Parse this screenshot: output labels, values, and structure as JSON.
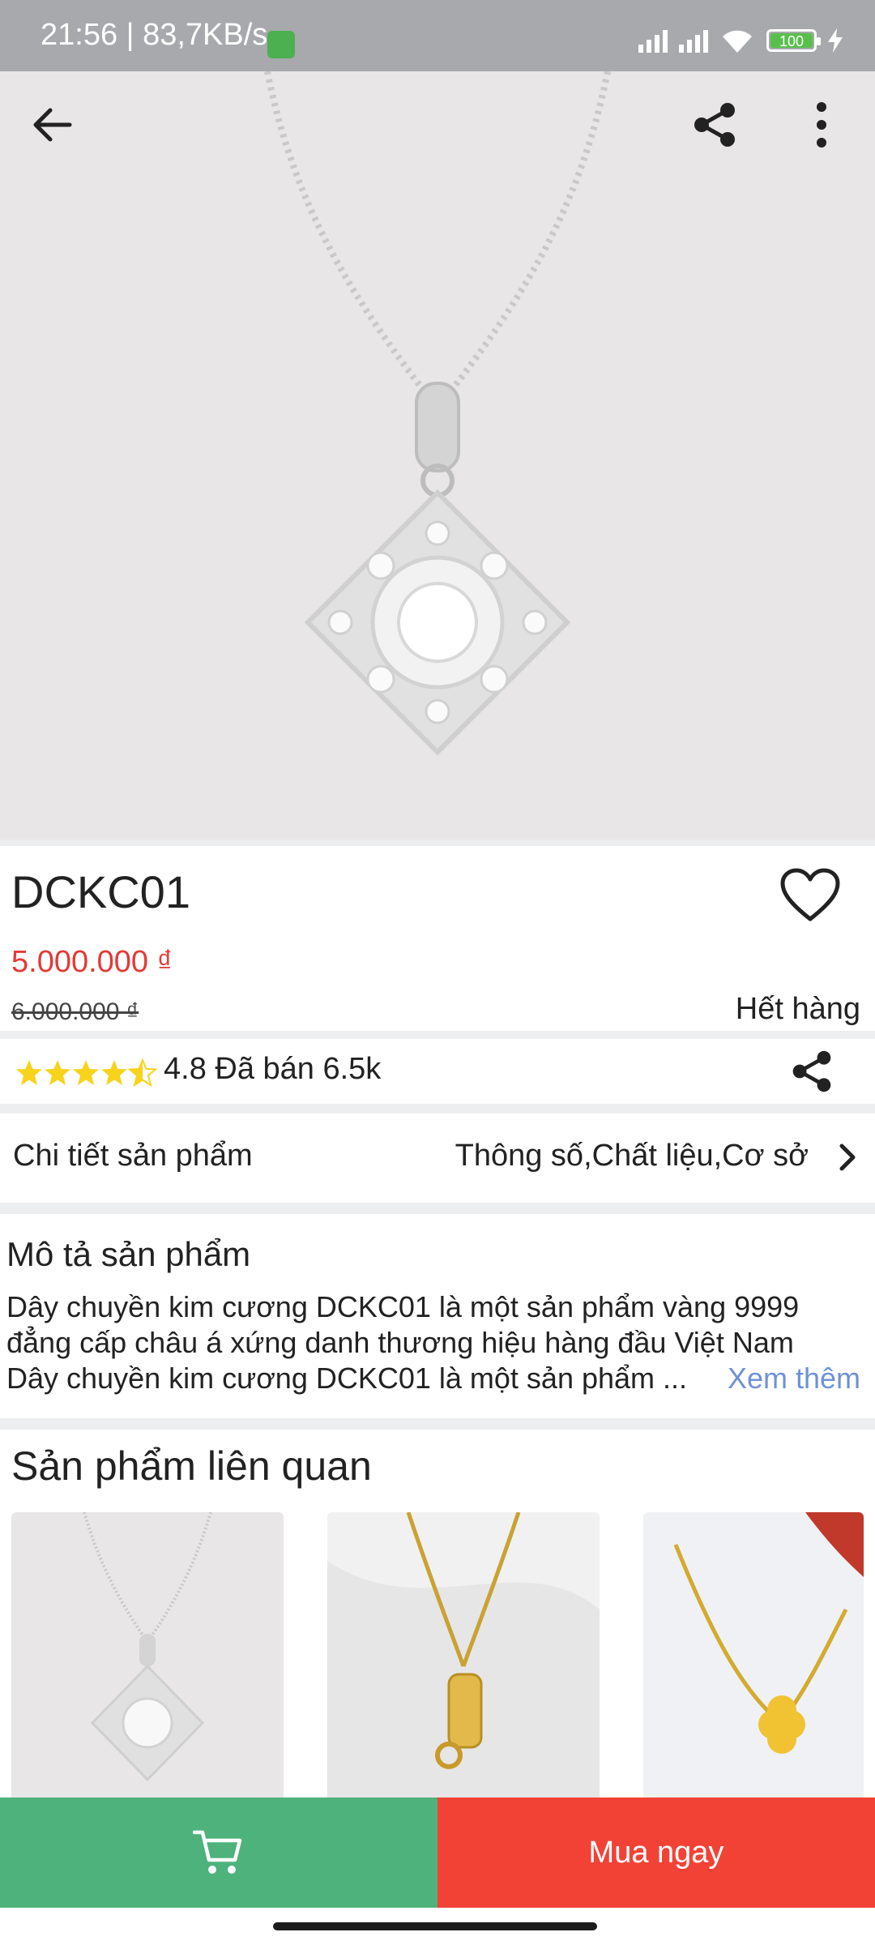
{
  "status_bar": {
    "time_speed": "21:56 | 83,7KB/s",
    "battery": "100"
  },
  "toolbar": {
    "back_icon": "arrow-left-icon",
    "share_icon": "share-icon",
    "more_icon": "more-vertical-icon"
  },
  "product": {
    "name": "DCKC01",
    "price": "5.000.000 ₫",
    "old_price": "6.000.000 ₫",
    "stock_status": "Hết hàng",
    "rating": 4.5,
    "rating_text": "4.8 Đã bán 6.5k"
  },
  "details": {
    "label": "Chi tiết sản phẩm",
    "value": "Thông số,Chất liệu,Cơ sở"
  },
  "description": {
    "title": "Mô tả sản phẩm",
    "line1": "Dây chuyền kim cương DCKC01 là một sản phẩm vàng 9999",
    "line2": "đẳng cấp châu á xứng danh thương hiệu hàng đầu Việt Nam",
    "line3": "Dây chuyền kim cương DCKC01 là một sản phẩm ...",
    "see_more": "Xem thêm"
  },
  "related": {
    "title": "Sản phẩm liên quan"
  },
  "bottom_bar": {
    "buy_label": "Mua ngay"
  },
  "colors": {
    "price_red": "#e53935",
    "cart_green": "#4eb27c",
    "buy_red": "#f24236",
    "link_blue": "#6f92d6"
  }
}
